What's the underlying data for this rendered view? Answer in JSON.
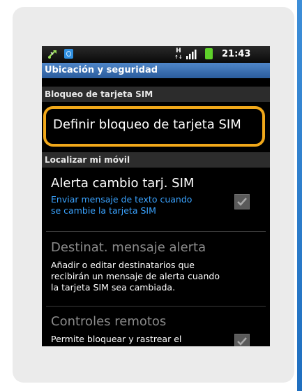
{
  "status_bar": {
    "network_type": "H",
    "network_sub": "↑↓",
    "time": "21:43",
    "icons": [
      "usb-icon",
      "app-notification-icon",
      "signal-icon",
      "battery-icon"
    ]
  },
  "screen_title": "Ubicación y seguridad",
  "sections": {
    "sim_lock": "Bloqueo de tarjeta SIM",
    "find_phone": "Localizar mi móvil"
  },
  "sim_lock_item": {
    "title": "Definir bloqueo de tarjeta SIM"
  },
  "sim_change_alert": {
    "title": "Alerta cambio tarj. SIM",
    "subtitle_line1": "Enviar mensaje de texto cuando",
    "subtitle_line2": "se cambie la tarjeta SIM",
    "checked": true
  },
  "alert_recipients": {
    "title": "Destinat. mensaje alerta",
    "desc_line1": "Añadir o editar destinatarios que",
    "desc_line2": "recibirán un mensaje de alerta cuando",
    "desc_line3": "la tarjeta SIM sea cambiada."
  },
  "remote_controls": {
    "title": "Controles remotos",
    "desc_line1": "Permite bloquear y rastrear el",
    "checked": true
  },
  "colors": {
    "highlight_ring": "#f1a81a",
    "title_bar": "#2a5c9c",
    "link_text": "#3aa3ff",
    "edge_accent": "#1f6fc0"
  }
}
